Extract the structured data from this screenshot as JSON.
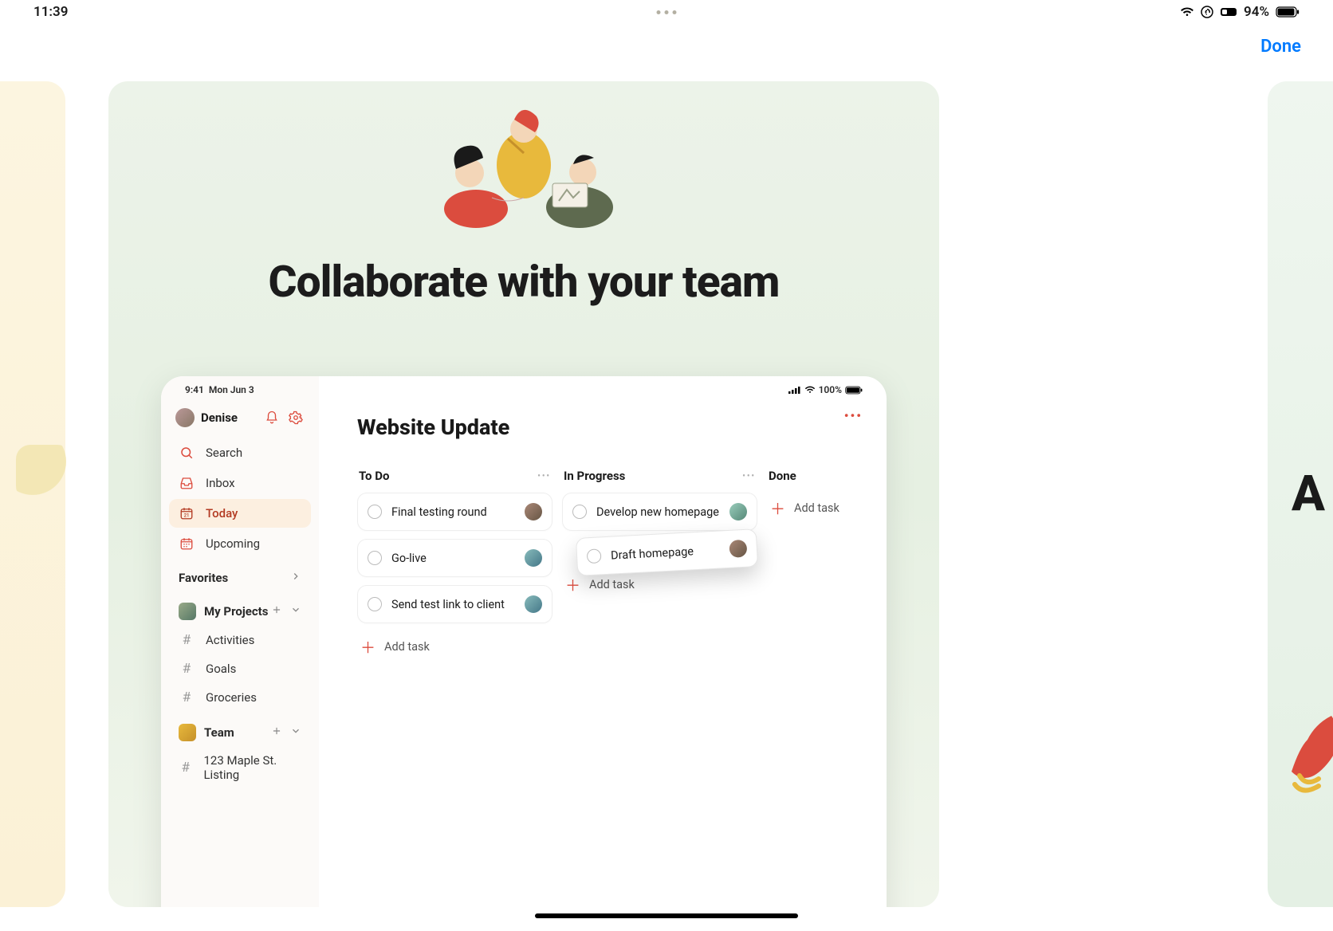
{
  "outer_status": {
    "time": "11:39",
    "battery": "94%"
  },
  "done_label": "Done",
  "hero": {
    "title": "Collaborate with your team"
  },
  "next_slide_peek": "A",
  "mock": {
    "status": {
      "time": "9:41",
      "date": "Mon Jun 3",
      "battery": "100%"
    },
    "user": "Denise",
    "nav": {
      "search": "Search",
      "inbox": "Inbox",
      "today": "Today",
      "upcoming": "Upcoming"
    },
    "sections": {
      "favorites": {
        "label": "Favorites"
      },
      "myprojects": {
        "label": "My Projects",
        "items": [
          "Activities",
          "Goals",
          "Groceries"
        ]
      },
      "team": {
        "label": "Team",
        "items": [
          "123 Maple St. Listing"
        ]
      }
    },
    "board": {
      "title": "Website Update",
      "columns": {
        "todo": {
          "label": "To Do",
          "tasks": [
            "Final testing round",
            "Go-live",
            "Send test link to client"
          ],
          "add": "Add task"
        },
        "inprogress": {
          "label": "In Progress",
          "tasks": [
            "Develop new homepage"
          ],
          "dragging": "Draft homepage",
          "add": "Add task"
        },
        "done": {
          "label": "Done",
          "add": "Add task"
        }
      }
    }
  }
}
